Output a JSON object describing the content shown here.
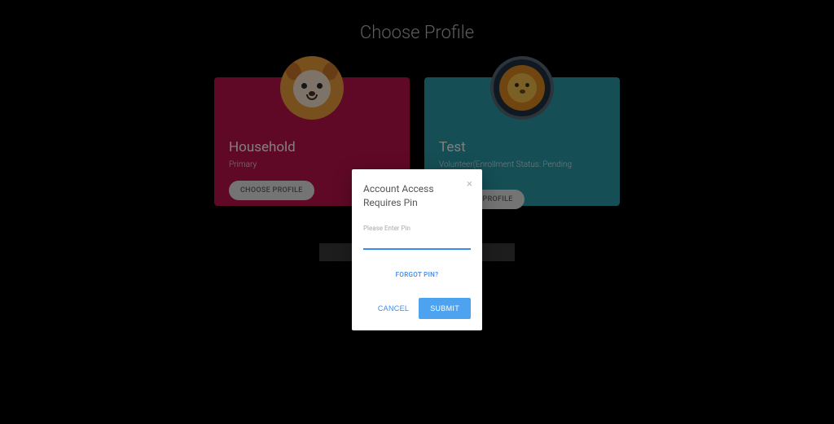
{
  "header": {
    "title": "Choose Profile"
  },
  "profiles": [
    {
      "name": "Household",
      "subtitle": "Primary",
      "button_label": "CHOOSE PROFILE",
      "avatar": "deer-icon"
    },
    {
      "name": "Test",
      "subtitle": "Volunteer(Enrollment Status: Pending Approval)",
      "button_label": "CHOOSE PROFILE",
      "avatar": "lion-icon"
    }
  ],
  "modal": {
    "title": "Account Access Requires Pin",
    "input_label": "Please Enter Pin",
    "input_value": "",
    "forgot_label": "FORGOT PIN?",
    "cancel_label": "CANCEL",
    "submit_label": "SUBMIT"
  }
}
